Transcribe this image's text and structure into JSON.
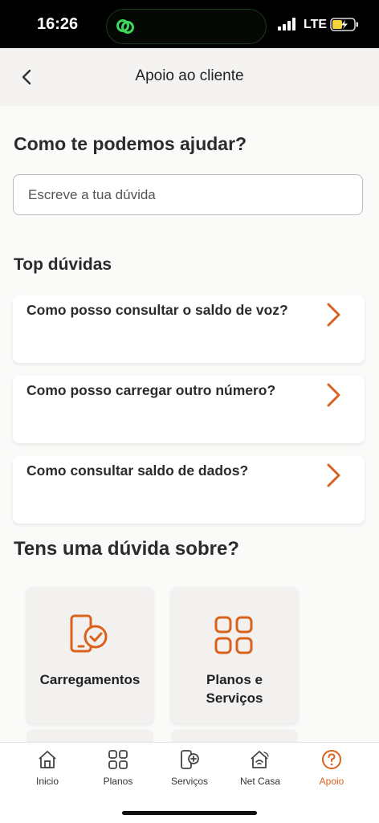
{
  "status": {
    "time": "16:26",
    "network": "LTE"
  },
  "header": {
    "title": "Apoio ao cliente"
  },
  "help": {
    "heading": "Como te podemos ajudar?",
    "search_placeholder": "Escreve a tua dúvida"
  },
  "top": {
    "heading": "Top dúvidas",
    "items": [
      {
        "label": "Como posso consultar o saldo de voz?"
      },
      {
        "label": "Como posso carregar outro número?"
      },
      {
        "label": "Como consultar saldo de dados?"
      }
    ]
  },
  "topics": {
    "heading": "Tens uma dúvida sobre?",
    "items": [
      {
        "label": "Carregamentos",
        "icon": "phone-check-icon"
      },
      {
        "label": "Planos e Serviços",
        "icon": "grid-icon"
      }
    ]
  },
  "tabs": [
    {
      "label": "Inicio",
      "icon": "home-icon"
    },
    {
      "label": "Planos",
      "icon": "grid-icon"
    },
    {
      "label": "Serviços",
      "icon": "phone-plus-icon"
    },
    {
      "label": "Net Casa",
      "icon": "home-wifi-icon"
    },
    {
      "label": "Apoio",
      "icon": "help-circle-icon",
      "active": true
    }
  ],
  "colors": {
    "accent": "#d9621c",
    "text": "#2b2b2b",
    "background": "#fafaf9"
  }
}
